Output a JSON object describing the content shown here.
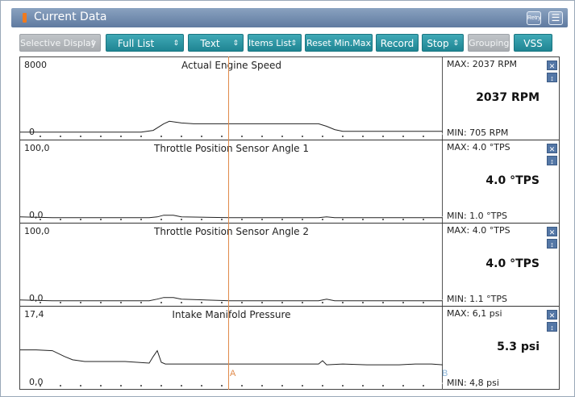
{
  "window": {
    "title": "Current Data",
    "title_buttons": [
      "retry-icon",
      "menu-icon"
    ],
    "retry_label": "Retry",
    "menu_glyph": "☰"
  },
  "toolbar": {
    "selective_display": "Selective Display",
    "full_list": "Full List",
    "text": "Text",
    "items_list": "Items List",
    "reset_min_max": "Reset Min.Max",
    "record": "Record",
    "stop": "Stop",
    "grouping": "Grouping",
    "vss": "VSS",
    "arrows": "⇕"
  },
  "panels": [
    {
      "title": "Actual Engine Speed",
      "axis_max": "8000",
      "axis_min": "0",
      "max_label": "MAX:  2037 RPM",
      "min_label": "MIN:   705 RPM",
      "current": "2037 RPM",
      "trace": [
        [
          0,
          0.9
        ],
        [
          30,
          0.9
        ],
        [
          60,
          0.9
        ],
        [
          90,
          0.9
        ],
        [
          120,
          0.9
        ],
        [
          150,
          0.9
        ],
        [
          165,
          0.88
        ],
        [
          178,
          0.8
        ],
        [
          185,
          0.77
        ],
        [
          200,
          0.79
        ],
        [
          215,
          0.8
        ],
        [
          260,
          0.8
        ],
        [
          300,
          0.8
        ],
        [
          340,
          0.8
        ],
        [
          370,
          0.8
        ],
        [
          380,
          0.83
        ],
        [
          390,
          0.87
        ],
        [
          400,
          0.89
        ],
        [
          430,
          0.89
        ],
        [
          470,
          0.89
        ],
        [
          510,
          0.89
        ],
        [
          524,
          0.89
        ]
      ]
    },
    {
      "title": "Throttle Position Sensor Angle 1",
      "axis_max": "100,0",
      "axis_min": "0,0",
      "max_label": "MAX:   4.0 °TPS",
      "min_label": "MIN:   1.0 °TPS",
      "current": "4.0 °TPS",
      "trace": [
        [
          0,
          0.92
        ],
        [
          40,
          0.93
        ],
        [
          80,
          0.93
        ],
        [
          120,
          0.93
        ],
        [
          160,
          0.93
        ],
        [
          170,
          0.92
        ],
        [
          178,
          0.9
        ],
        [
          190,
          0.9
        ],
        [
          200,
          0.92
        ],
        [
          260,
          0.93
        ],
        [
          300,
          0.93
        ],
        [
          340,
          0.93
        ],
        [
          370,
          0.93
        ],
        [
          380,
          0.92
        ],
        [
          390,
          0.93
        ],
        [
          440,
          0.93
        ],
        [
          524,
          0.93
        ]
      ]
    },
    {
      "title": "Throttle Position Sensor Angle 2",
      "axis_max": "100,0",
      "axis_min": "0,0",
      "max_label": "MAX:   4.0 °TPS",
      "min_label": "MIN:   1.1 °TPS",
      "current": "4.0 °TPS",
      "trace": [
        [
          0,
          0.92
        ],
        [
          40,
          0.93
        ],
        [
          80,
          0.93
        ],
        [
          120,
          0.93
        ],
        [
          160,
          0.93
        ],
        [
          170,
          0.91
        ],
        [
          178,
          0.89
        ],
        [
          190,
          0.89
        ],
        [
          200,
          0.91
        ],
        [
          260,
          0.93
        ],
        [
          300,
          0.93
        ],
        [
          340,
          0.93
        ],
        [
          370,
          0.93
        ],
        [
          380,
          0.91
        ],
        [
          390,
          0.93
        ],
        [
          440,
          0.93
        ],
        [
          524,
          0.93
        ]
      ]
    },
    {
      "title": "Intake Manifold Pressure",
      "axis_max": "17,4",
      "axis_min": "0,0",
      "max_label": "MAX:   6,1 psi",
      "min_label": "MIN:   4,8 psi",
      "current": "5.3 psi",
      "trace": [
        [
          0,
          0.52
        ],
        [
          20,
          0.52
        ],
        [
          40,
          0.53
        ],
        [
          55,
          0.6
        ],
        [
          65,
          0.64
        ],
        [
          80,
          0.66
        ],
        [
          100,
          0.66
        ],
        [
          130,
          0.66
        ],
        [
          160,
          0.68
        ],
        [
          165,
          0.6
        ],
        [
          170,
          0.53
        ],
        [
          175,
          0.67
        ],
        [
          180,
          0.69
        ],
        [
          220,
          0.69
        ],
        [
          260,
          0.69
        ],
        [
          300,
          0.69
        ],
        [
          340,
          0.69
        ],
        [
          370,
          0.69
        ],
        [
          375,
          0.65
        ],
        [
          380,
          0.7
        ],
        [
          400,
          0.69
        ],
        [
          430,
          0.7
        ],
        [
          470,
          0.7
        ],
        [
          490,
          0.69
        ],
        [
          510,
          0.69
        ],
        [
          524,
          0.7
        ]
      ]
    }
  ],
  "cursor": {
    "a_label": "A",
    "b_label": "B"
  },
  "colors": {
    "accent": "#1f8593",
    "title_bar": "#6d88ad",
    "cursor": "#e08a4a"
  }
}
